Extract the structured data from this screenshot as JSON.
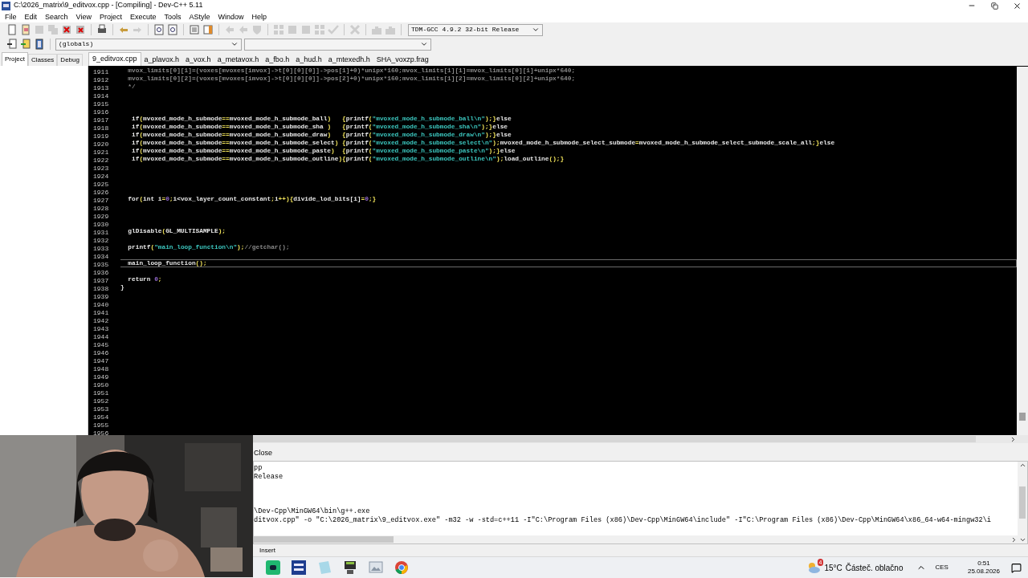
{
  "window": {
    "title": "C:\\2026_matrix\\9_editvox.cpp - [Compiling] - Dev-C++ 5.11"
  },
  "menu": [
    "File",
    "Edit",
    "Search",
    "View",
    "Project",
    "Execute",
    "Tools",
    "AStyle",
    "Window",
    "Help"
  ],
  "compiler_select": {
    "value": "TDM-GCC 4.9.2 32-bit Release"
  },
  "scope_select": {
    "value": "(globals)"
  },
  "side_tabs": [
    {
      "label": "Project",
      "selected": true
    },
    {
      "label": "Classes",
      "selected": false
    },
    {
      "label": "Debug",
      "selected": false
    }
  ],
  "editor_tabs": [
    {
      "label": "9_editvox.cpp",
      "selected": true
    },
    {
      "label": "a_plavox.h",
      "selected": false
    },
    {
      "label": "a_vox.h",
      "selected": false
    },
    {
      "label": "a_metavox.h",
      "selected": false
    },
    {
      "label": "a_fbo.h",
      "selected": false
    },
    {
      "label": "a_hud.h",
      "selected": false
    },
    {
      "label": "a_mtexedh.h",
      "selected": false
    },
    {
      "label": "SHA_voxzp.frag",
      "selected": false
    }
  ],
  "code_lines": [
    {
      "number": "1911",
      "current": false,
      "tokens": [
        {
          "kind": "cmt",
          "text": "  mvox_limits[0][1]=(voxes[mvoxes[imvox]->t[0][0][0]]->pos[1]+0)*unipx*160;mvox_limits[1][1]=mvox_limits[0][1]+unipx*640;"
        }
      ]
    },
    {
      "number": "1912",
      "current": false,
      "tokens": [
        {
          "kind": "cmt",
          "text": "  mvox_limits[0][2]=(voxes[mvoxes[imvox]->t[0][0][0]]->pos[2]+0)*unipx*160;mvox_limits[1][2]=mvox_limits[0][2]+unipx*640;"
        }
      ]
    },
    {
      "number": "1913",
      "current": false,
      "tokens": [
        {
          "kind": "cmt",
          "text": "  */"
        }
      ]
    },
    {
      "number": "1914",
      "current": false
    },
    {
      "number": "1915",
      "current": false
    },
    {
      "number": "1916",
      "current": false
    },
    {
      "number": "1917",
      "current": false,
      "tokens": [
        {
          "kind": "txt",
          "text": "   if"
        },
        {
          "kind": "sym",
          "text": "("
        },
        {
          "kind": "txt",
          "text": "mvoxed_mode_h_submode"
        },
        {
          "kind": "sym",
          "text": "=="
        },
        {
          "kind": "txt",
          "text": "mvoxed_mode_h_submode_ball"
        },
        {
          "kind": "sym",
          "text": ")   {"
        },
        {
          "kind": "txt",
          "text": "printf"
        },
        {
          "kind": "sym",
          "text": "("
        },
        {
          "kind": "str",
          "text": "\"mvoxed_mode_h_submode_ball\\n\""
        },
        {
          "kind": "sym",
          "text": ");}"
        },
        {
          "kind": "txt",
          "text": "else"
        }
      ]
    },
    {
      "number": "1918",
      "current": false,
      "tokens": [
        {
          "kind": "txt",
          "text": "   if"
        },
        {
          "kind": "sym",
          "text": "("
        },
        {
          "kind": "txt",
          "text": "mvoxed_mode_h_submode"
        },
        {
          "kind": "sym",
          "text": "=="
        },
        {
          "kind": "txt",
          "text": "mvoxed_mode_h_submode_sha "
        },
        {
          "kind": "sym",
          "text": ")   {"
        },
        {
          "kind": "txt",
          "text": "printf"
        },
        {
          "kind": "sym",
          "text": "("
        },
        {
          "kind": "str",
          "text": "\"mvoxed_mode_h_submode_sha\\n\""
        },
        {
          "kind": "sym",
          "text": ");}"
        },
        {
          "kind": "txt",
          "text": "else"
        }
      ]
    },
    {
      "number": "1919",
      "current": false,
      "tokens": [
        {
          "kind": "txt",
          "text": "   if"
        },
        {
          "kind": "sym",
          "text": "("
        },
        {
          "kind": "txt",
          "text": "mvoxed_mode_h_submode"
        },
        {
          "kind": "sym",
          "text": "=="
        },
        {
          "kind": "txt",
          "text": "mvoxed_mode_h_submode_draw"
        },
        {
          "kind": "sym",
          "text": ")   {"
        },
        {
          "kind": "txt",
          "text": "printf"
        },
        {
          "kind": "sym",
          "text": "("
        },
        {
          "kind": "str",
          "text": "\"mvoxed_mode_h_submode_draw\\n\""
        },
        {
          "kind": "sym",
          "text": ");}"
        },
        {
          "kind": "txt",
          "text": "else"
        }
      ]
    },
    {
      "number": "1920",
      "current": false,
      "tokens": [
        {
          "kind": "txt",
          "text": "   if"
        },
        {
          "kind": "sym",
          "text": "("
        },
        {
          "kind": "txt",
          "text": "mvoxed_mode_h_submode"
        },
        {
          "kind": "sym",
          "text": "=="
        },
        {
          "kind": "txt",
          "text": "mvoxed_mode_h_submode_select"
        },
        {
          "kind": "sym",
          "text": ") {"
        },
        {
          "kind": "txt",
          "text": "printf"
        },
        {
          "kind": "sym",
          "text": "("
        },
        {
          "kind": "str",
          "text": "\"mvoxed_mode_h_submode_select\\n\""
        },
        {
          "kind": "sym",
          "text": ");"
        },
        {
          "kind": "txt",
          "text": "mvoxed_mode_h_submode_select_submode"
        },
        {
          "kind": "sym",
          "text": "="
        },
        {
          "kind": "txt",
          "text": "mvoxed_mode_h_submode_select_submode_scale_all"
        },
        {
          "kind": "sym",
          "text": ";}"
        },
        {
          "kind": "txt",
          "text": "else"
        }
      ]
    },
    {
      "number": "1921",
      "current": false,
      "tokens": [
        {
          "kind": "txt",
          "text": "   if"
        },
        {
          "kind": "sym",
          "text": "("
        },
        {
          "kind": "txt",
          "text": "mvoxed_mode_h_submode"
        },
        {
          "kind": "sym",
          "text": "=="
        },
        {
          "kind": "txt",
          "text": "mvoxed_mode_h_submode_paste"
        },
        {
          "kind": "sym",
          "text": ")  {"
        },
        {
          "kind": "txt",
          "text": "printf"
        },
        {
          "kind": "sym",
          "text": "("
        },
        {
          "kind": "str",
          "text": "\"mvoxed_mode_h_submode_paste\\n\""
        },
        {
          "kind": "sym",
          "text": ");}"
        },
        {
          "kind": "txt",
          "text": "else"
        }
      ]
    },
    {
      "number": "1922",
      "current": false,
      "tokens": [
        {
          "kind": "txt",
          "text": "   if"
        },
        {
          "kind": "sym",
          "text": "("
        },
        {
          "kind": "txt",
          "text": "mvoxed_mode_h_submode"
        },
        {
          "kind": "sym",
          "text": "=="
        },
        {
          "kind": "txt",
          "text": "mvoxed_mode_h_submode_outline"
        },
        {
          "kind": "sym",
          "text": "){"
        },
        {
          "kind": "txt",
          "text": "printf"
        },
        {
          "kind": "sym",
          "text": "("
        },
        {
          "kind": "str",
          "text": "\"mvoxed_mode_h_submode_outline\\n\""
        },
        {
          "kind": "sym",
          "text": ");"
        },
        {
          "kind": "txt",
          "text": "load_outline"
        },
        {
          "kind": "sym",
          "text": "();}"
        }
      ]
    },
    {
      "number": "1923",
      "current": false
    },
    {
      "number": "1924",
      "current": false
    },
    {
      "number": "1925",
      "current": false
    },
    {
      "number": "1926",
      "current": false
    },
    {
      "number": "1927",
      "current": false,
      "tokens": [
        {
          "kind": "txt",
          "text": "  for"
        },
        {
          "kind": "sym",
          "text": "("
        },
        {
          "kind": "txt",
          "text": "int i"
        },
        {
          "kind": "sym",
          "text": "="
        },
        {
          "kind": "num",
          "text": "0"
        },
        {
          "kind": "sym",
          "text": ";"
        },
        {
          "kind": "txt",
          "text": "i<vox_layer_count_constant"
        },
        {
          "kind": "sym",
          "text": ";"
        },
        {
          "kind": "txt",
          "text": "i"
        },
        {
          "kind": "sym",
          "text": "++){"
        },
        {
          "kind": "txt",
          "text": "divide_lod_bits[i]"
        },
        {
          "kind": "sym",
          "text": "="
        },
        {
          "kind": "num",
          "text": "0"
        },
        {
          "kind": "sym",
          "text": ";}"
        }
      ]
    },
    {
      "number": "1928",
      "current": false
    },
    {
      "number": "1929",
      "current": false
    },
    {
      "number": "1930",
      "current": false
    },
    {
      "number": "1931",
      "current": false,
      "tokens": [
        {
          "kind": "txt",
          "text": "  glDisable"
        },
        {
          "kind": "sym",
          "text": "("
        },
        {
          "kind": "txt",
          "text": "GL_MULTISAMPLE"
        },
        {
          "kind": "sym",
          "text": ");"
        }
      ]
    },
    {
      "number": "1932",
      "current": false
    },
    {
      "number": "1933",
      "current": false,
      "tokens": [
        {
          "kind": "txt",
          "text": "  printf"
        },
        {
          "kind": "sym",
          "text": "("
        },
        {
          "kind": "str",
          "text": "\"main_loop_function\\n\""
        },
        {
          "kind": "sym",
          "text": ");"
        },
        {
          "kind": "cmt",
          "text": "//getchar();"
        }
      ]
    },
    {
      "number": "1934",
      "current": false
    },
    {
      "number": "1935",
      "current": true,
      "tokens": [
        {
          "kind": "txt",
          "text": "  main_loop_function"
        },
        {
          "kind": "sym",
          "text": "();"
        }
      ]
    },
    {
      "number": "1936",
      "current": false
    },
    {
      "number": "1937",
      "current": false,
      "tokens": [
        {
          "kind": "txt",
          "text": "  return "
        },
        {
          "kind": "num",
          "text": "0"
        },
        {
          "kind": "sym",
          "text": ";"
        }
      ]
    },
    {
      "number": "1938",
      "current": false,
      "tokens": [
        {
          "kind": "txt",
          "text": "}"
        }
      ]
    },
    {
      "number": "1939",
      "current": false
    },
    {
      "number": "1940",
      "current": false
    },
    {
      "number": "1941",
      "current": false
    },
    {
      "number": "1942",
      "current": false
    },
    {
      "number": "1943",
      "current": false
    },
    {
      "number": "1944",
      "current": false
    },
    {
      "number": "1945",
      "current": false
    },
    {
      "number": "1946",
      "current": false
    },
    {
      "number": "1947",
      "current": false
    },
    {
      "number": "1948",
      "current": false
    },
    {
      "number": "1949",
      "current": false
    },
    {
      "number": "1950",
      "current": false
    },
    {
      "number": "1951",
      "current": false
    },
    {
      "number": "1952",
      "current": false
    },
    {
      "number": "1953",
      "current": false
    },
    {
      "number": "1954",
      "current": false
    },
    {
      "number": "1955",
      "current": false
    },
    {
      "number": "1956",
      "current": false
    }
  ],
  "compiler_panel": {
    "tab": "Close",
    "output_groups": [
      [
        "pp",
        "Release"
      ],
      [
        "\\Dev-Cpp\\MinGW64\\bin\\g++.exe",
        "ditvox.cpp\" -o \"C:\\2026_matrix\\9_editvox.exe\" -m32 -w -std=c++11 -I\"C:\\Program Files (x86)\\Dev-Cpp\\MinGW64\\include\" -I\"C:\\Program Files (x86)\\Dev-Cpp\\MinGW64\\x86_64-w64-mingw32\\i"
      ]
    ]
  },
  "status_bar": {
    "mode": "Insert"
  },
  "taskbar": {
    "weather_badge": "4",
    "temperature": "15°C",
    "weather": "Částeč. oblačno",
    "language": "CES",
    "time": "0:51",
    "date": "25.08.2026"
  }
}
